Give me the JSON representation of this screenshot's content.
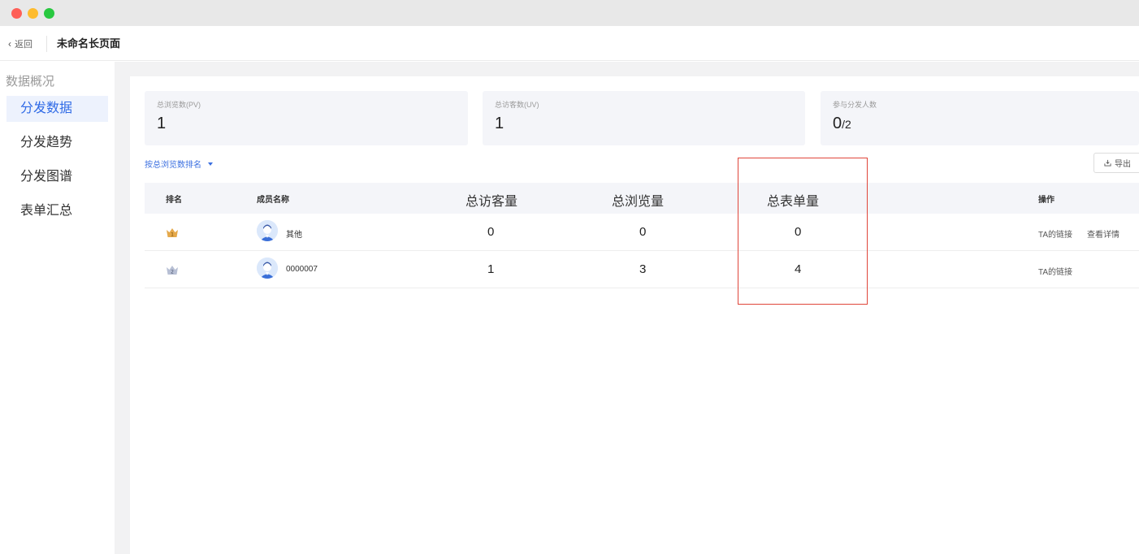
{
  "header": {
    "back_label": "返回",
    "page_title": "未命名长页面"
  },
  "sidebar": {
    "section_title": "数据概况",
    "items": [
      {
        "label": "分发数据",
        "active": true
      },
      {
        "label": "分发趋势",
        "active": false
      },
      {
        "label": "分发图谱",
        "active": false
      },
      {
        "label": "表单汇总",
        "active": false
      }
    ]
  },
  "stats": [
    {
      "label": "总浏览数(PV)",
      "value": "1"
    },
    {
      "label": "总访客数(UV)",
      "value": "1"
    },
    {
      "label": "参与分发人数",
      "value": "0",
      "denominator": "/2"
    }
  ],
  "toolbar": {
    "sort_label": "按总浏览数排名",
    "export_label": "导出"
  },
  "table": {
    "columns": [
      "排名",
      "成员名称",
      "总访客量",
      "总浏览量",
      "总表单量",
      "操作"
    ],
    "rows": [
      {
        "rank": "1",
        "member": "其他",
        "visitors": "0",
        "views": "0",
        "forms": "0",
        "actions": [
          "TA的链接",
          "查看详情"
        ]
      },
      {
        "rank": "2",
        "member": "0000007",
        "visitors": "1",
        "views": "3",
        "forms": "4",
        "actions": [
          "TA的链接"
        ]
      }
    ]
  },
  "colors": {
    "accent": "#2f6ae6",
    "active_bg": "#edf2fd",
    "highlight_border": "#e0463a",
    "gold_crown": "#e5a94b",
    "silver_crown": "#b7bfd4"
  }
}
